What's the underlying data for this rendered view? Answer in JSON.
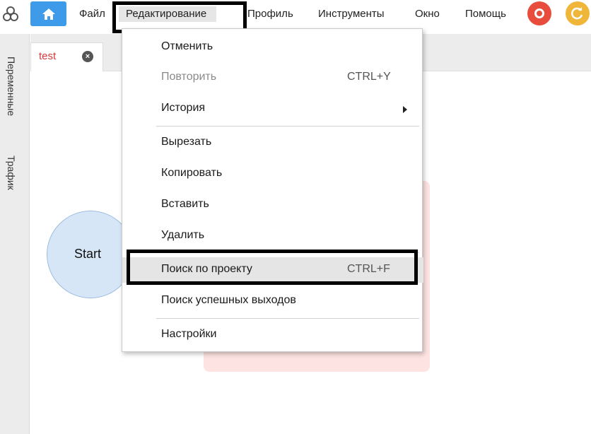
{
  "menubar": {
    "items": [
      {
        "label": "Файл"
      },
      {
        "label": "Редактирование"
      },
      {
        "label": "Профиль"
      },
      {
        "label": "Инструменты"
      },
      {
        "label": "Окно"
      },
      {
        "label": "Помощь"
      }
    ]
  },
  "sidebar": {
    "tabs": [
      {
        "label": "Переменные"
      },
      {
        "label": "Трафик"
      }
    ]
  },
  "tabs": [
    {
      "label": "test"
    }
  ],
  "canvas": {
    "start_label": "Start"
  },
  "edit_menu": {
    "items": [
      {
        "label": "Отменить",
        "shortcut": ""
      },
      {
        "label": "Повторить",
        "shortcut": "CTRL+Y",
        "disabled": true
      },
      {
        "label": "История",
        "shortcut": "",
        "submenu": true
      },
      {
        "label": "Вырезать",
        "shortcut": ""
      },
      {
        "label": "Копировать",
        "shortcut": ""
      },
      {
        "label": "Вставить",
        "shortcut": ""
      },
      {
        "label": "Удалить",
        "shortcut": ""
      },
      {
        "label": "Поиск по проекту",
        "shortcut": "CTRL+F"
      },
      {
        "label": "Поиск успешных выходов",
        "shortcut": ""
      },
      {
        "label": "Настройки",
        "shortcut": ""
      }
    ]
  },
  "colors": {
    "accent": "#3d9be9",
    "record": "#e84c3d",
    "refresh": "#f0b63a",
    "tab_label": "#d63a3a"
  }
}
